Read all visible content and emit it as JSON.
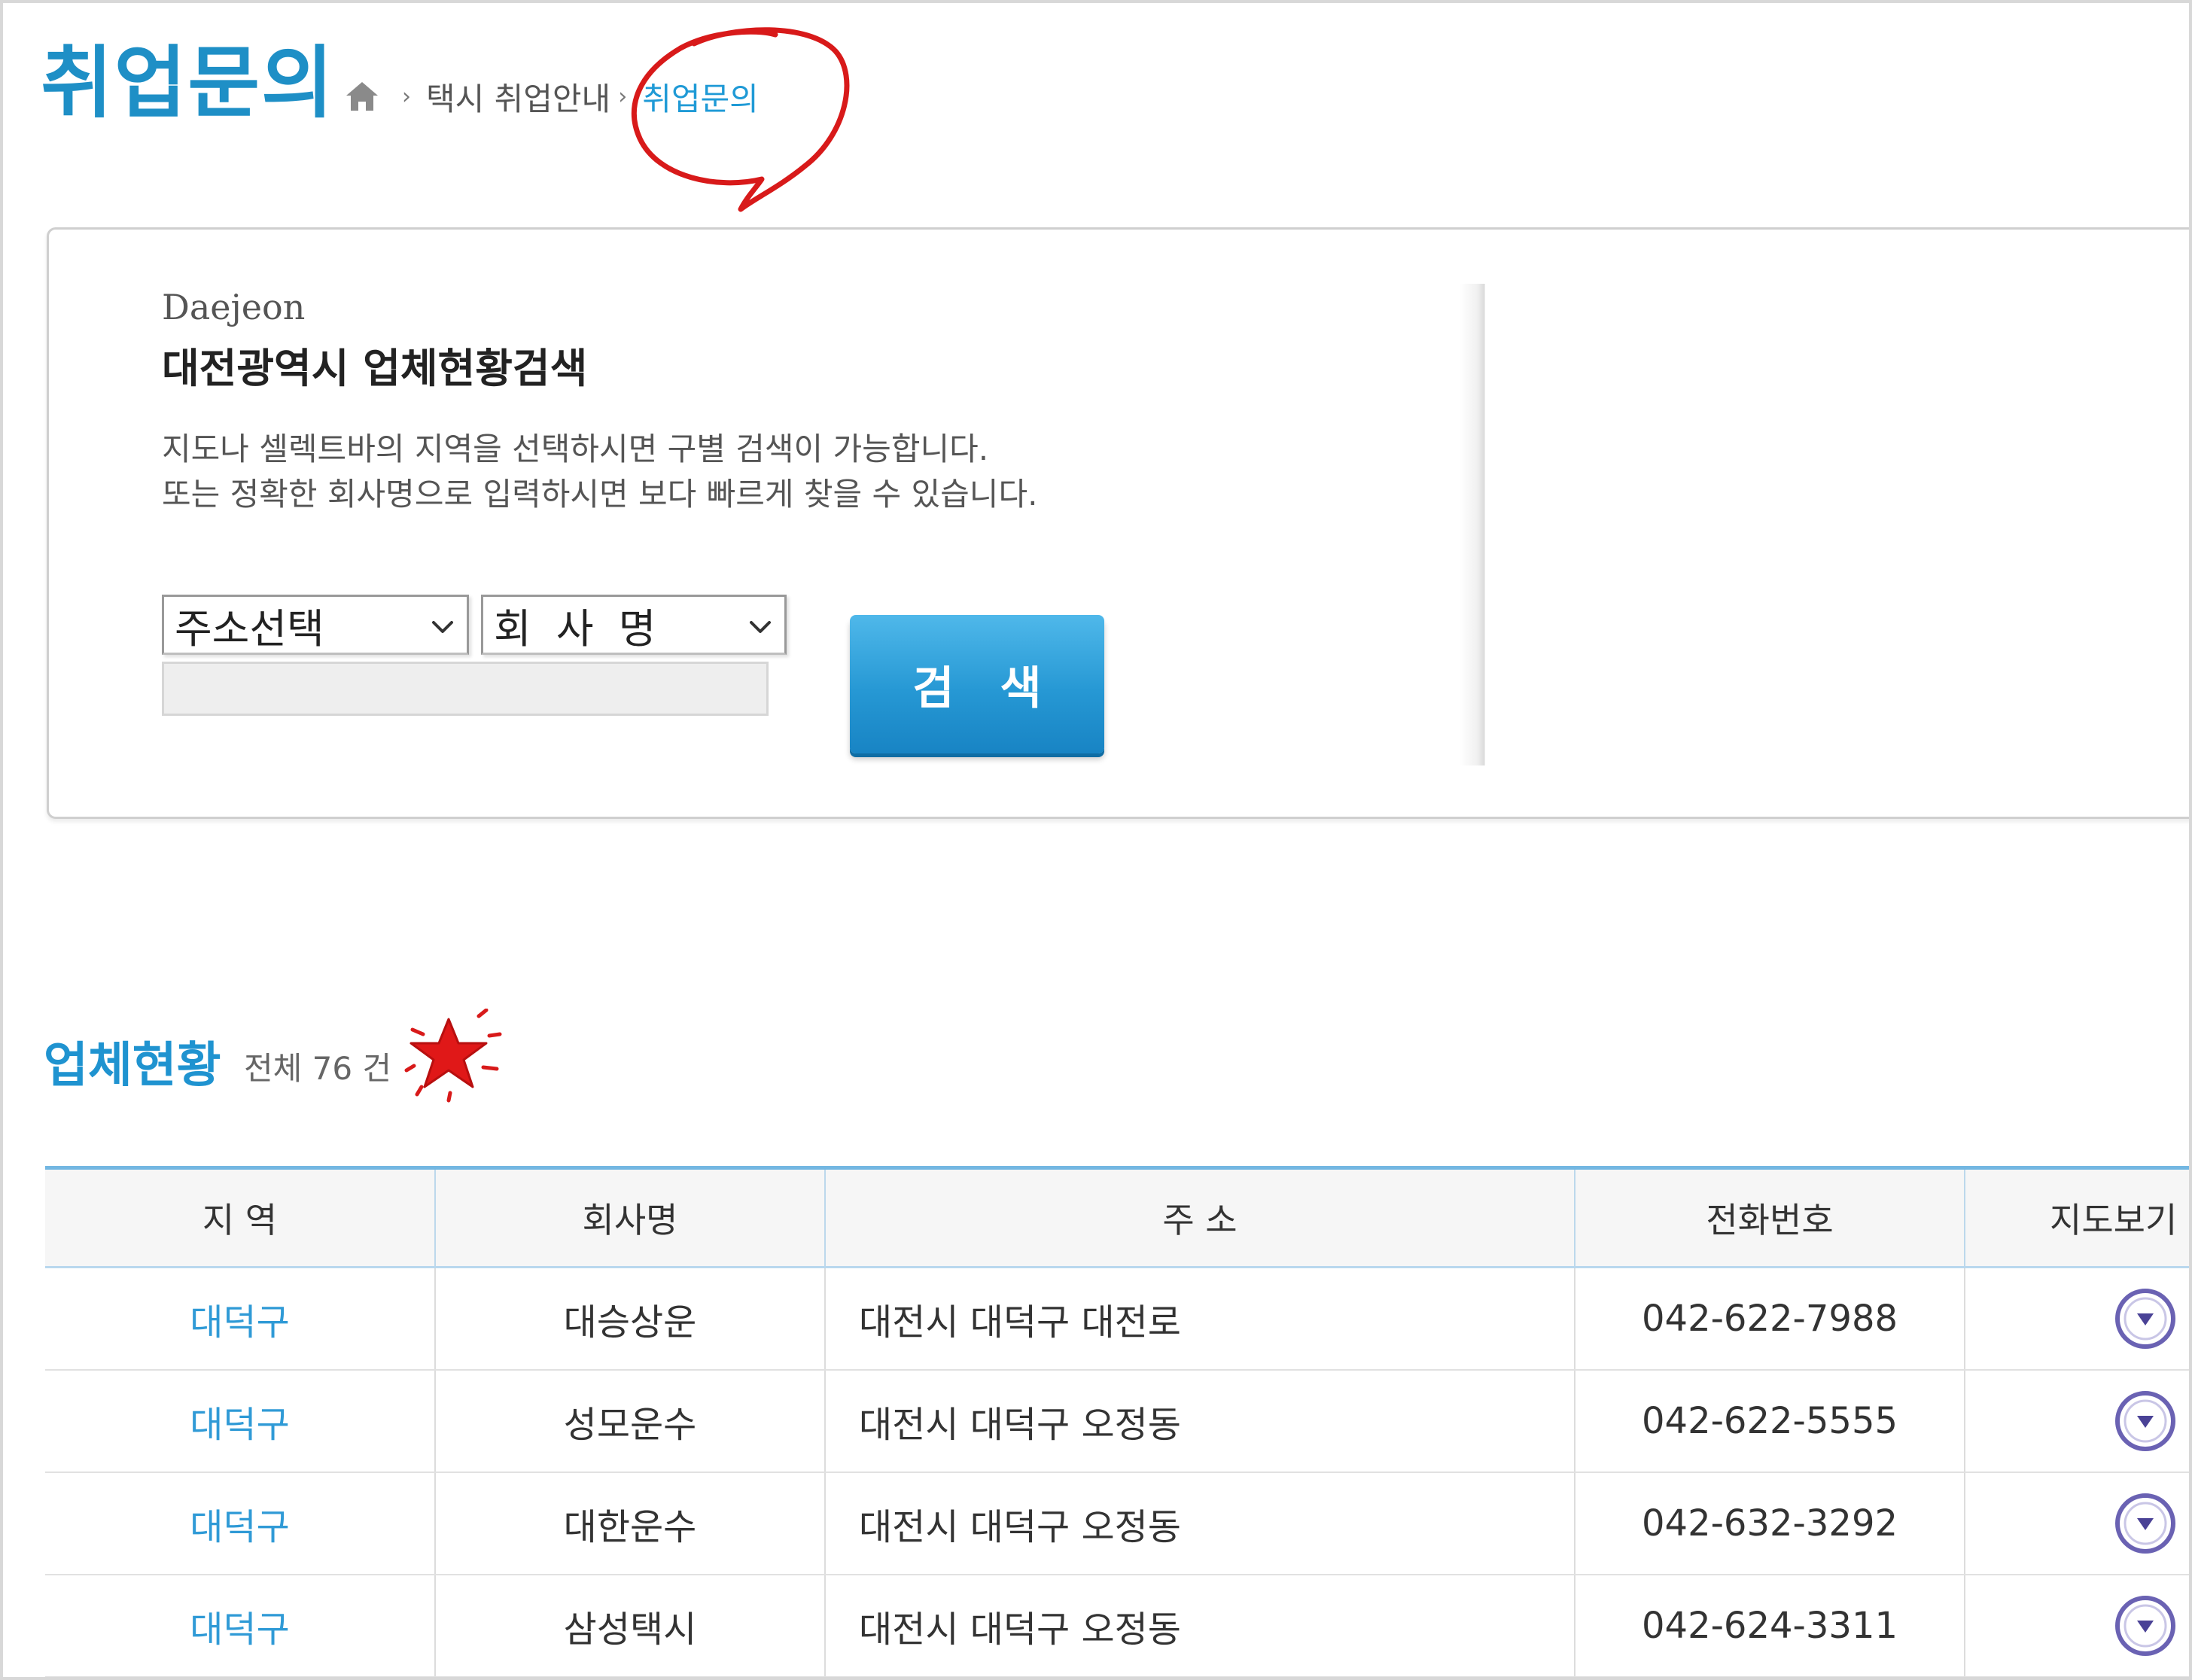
{
  "header": {
    "title": "취업문의",
    "breadcrumb": [
      {
        "label": "택시 취업안내"
      },
      {
        "label": "취업문의",
        "current": true
      }
    ]
  },
  "search": {
    "city_en": "Daejeon",
    "city_ko": "대전광역시 업체현황검색",
    "description": [
      "지도나 셀렉트바의 지역을 선택하시면 구별 검색이 가능합니다.",
      "또는 정확한 회사명으로 입력하시면 보다 빠르게 찾을 수 있습니다."
    ],
    "region_select": {
      "selected": "주소선택"
    },
    "field_select": {
      "selected": "회 사 명"
    },
    "input": {
      "value": ""
    },
    "button_label": "검 색"
  },
  "list": {
    "title": "업체현황",
    "count_text": "전체 76 건",
    "columns": [
      "지 역",
      "회사명",
      "주 소",
      "전화번호",
      "지도보기"
    ],
    "rows": [
      {
        "region": "대덕구",
        "company": "대승상운",
        "address": "대전시 대덕구 대전로",
        "phone": "042-622-7988"
      },
      {
        "region": "대덕구",
        "company": "성모운수",
        "address": "대전시 대덕구 오정동",
        "phone": "042-622-5555"
      },
      {
        "region": "대덕구",
        "company": "대한운수",
        "address": "대전시 대덕구 오정동",
        "phone": "042-632-3292"
      },
      {
        "region": "대덕구",
        "company": "삼성택시",
        "address": "대전시 대덕구 오정동",
        "phone": "042-624-3311"
      }
    ]
  },
  "colors": {
    "accent": "#1f93d0",
    "button": "#2698d4",
    "annotation": "#e01818",
    "map_button": "#6a62b3"
  },
  "icons": {
    "home": "home-icon",
    "breadcrumb_separator": "chevron-right-icon",
    "select_arrow": "chevron-down-icon",
    "map_button": "circle-down-arrow-icon"
  }
}
